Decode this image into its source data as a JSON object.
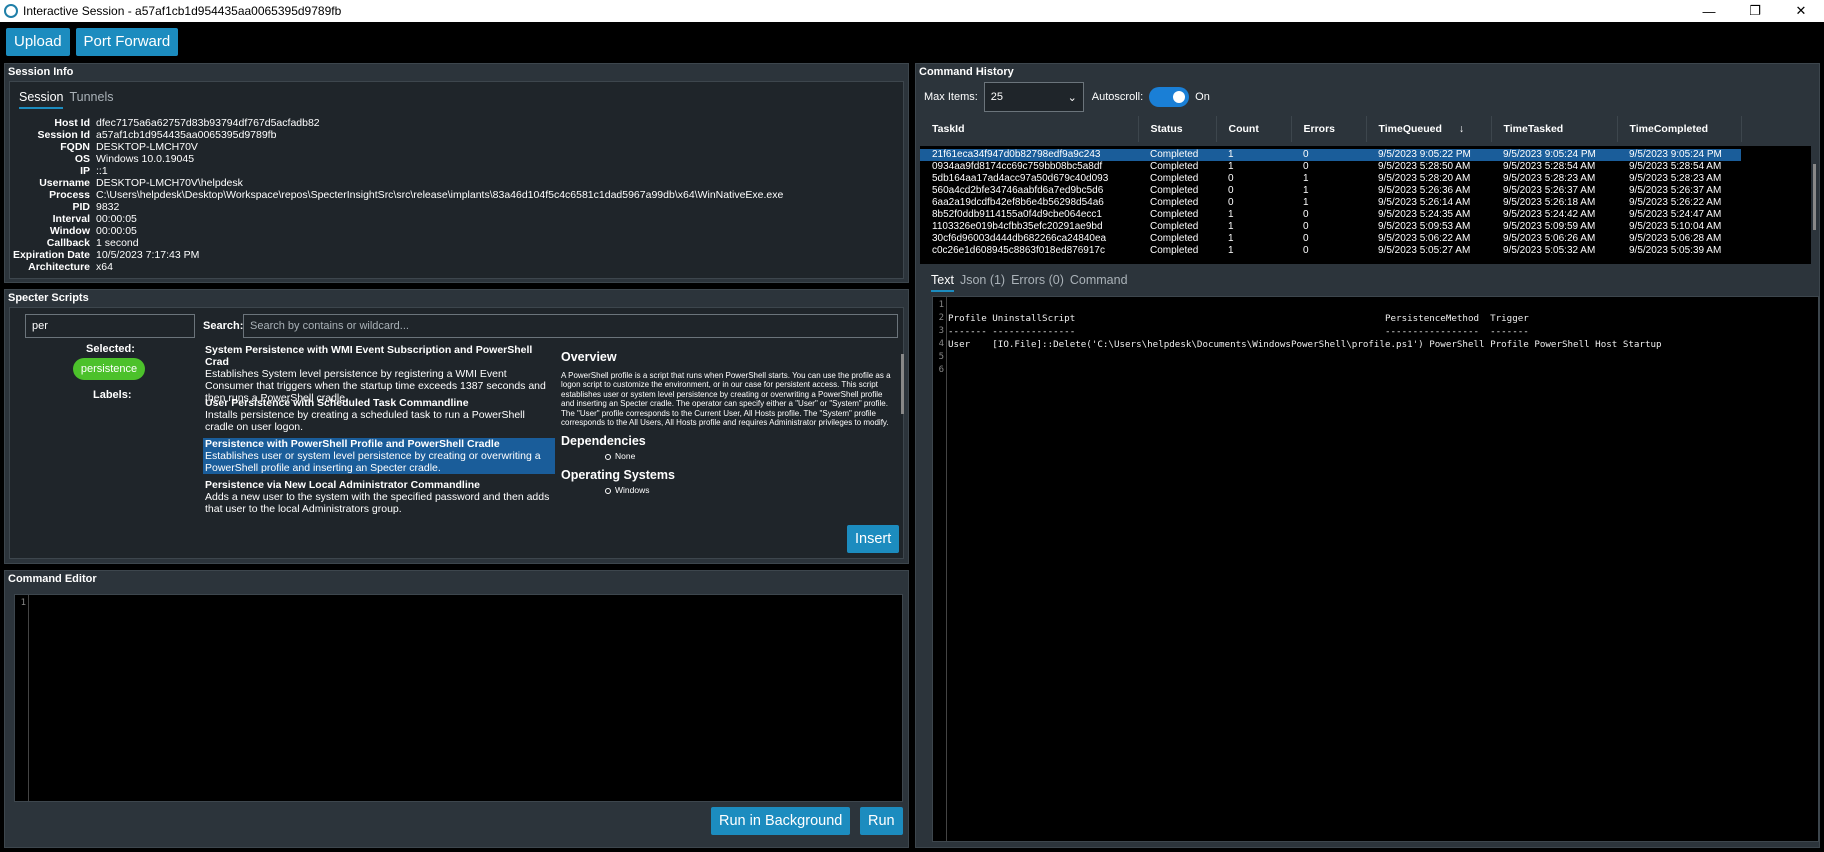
{
  "window": {
    "title": "Interactive Session - a57af1cb1d954435aa0065395d9789fb",
    "minimize": "—",
    "maximize": "❐",
    "close": "✕"
  },
  "toolbar": {
    "upload": "Upload",
    "port_forward": "Port Forward"
  },
  "session_info": {
    "header": "Session Info",
    "tabs": [
      "Session",
      "Tunnels"
    ],
    "fields": [
      {
        "k": "Host Id",
        "v": "dfec7175a6a62757d83b93794df767d5acfadb82"
      },
      {
        "k": "Session Id",
        "v": "a57af1cb1d954435aa0065395d9789fb"
      },
      {
        "k": "FQDN",
        "v": "DESKTOP-LMCH70V"
      },
      {
        "k": "OS",
        "v": "Windows 10.0.19045"
      },
      {
        "k": "IP",
        "v": "::1"
      },
      {
        "k": "Username",
        "v": "DESKTOP-LMCH70V\\helpdesk"
      },
      {
        "k": "Process",
        "v": "C:\\Users\\helpdesk\\Desktop\\Workspace\\repos\\SpecterInsightSrc\\src\\release\\implants\\83a46d104f5c4c6581c1dad5967a99db\\x64\\WinNativeExe.exe"
      },
      {
        "k": "PID",
        "v": "9832"
      },
      {
        "k": "Interval",
        "v": "00:00:05"
      },
      {
        "k": "Window",
        "v": "00:00:05"
      },
      {
        "k": "Callback",
        "v": "1 second"
      },
      {
        "k": "Expiration Date",
        "v": "10/5/2023 7:17:43 PM"
      },
      {
        "k": "Architecture",
        "v": "x64"
      }
    ]
  },
  "scripts": {
    "header": "Specter Scripts",
    "filter_value": "per",
    "search_label": "Search:",
    "search_placeholder": "Search by contains or wildcard...",
    "selected_label": "Selected:",
    "selected_pill": "persistence",
    "labels_label": "Labels:",
    "items": [
      {
        "name": "System Persistence with WMI Event Subscription and PowerShell Crad",
        "desc": "Establishes System level persistence by registering a WMI Event Consumer that triggers when the startup time exceeds 1387 seconds and then runs a PowerShell cradle."
      },
      {
        "name": "User Persistence with Scheduled Task Commandline",
        "desc": "Installs persistence by creating a scheduled task to run a PowerShell cradle on user logon."
      },
      {
        "name": "Persistence with PowerShell Profile and PowerShell Cradle",
        "desc": "Establishes user or system level persistence by creating or overwriting a PowerShell profile and inserting an Specter cradle."
      },
      {
        "name": "Persistence via New Local Administrator Commandline",
        "desc": "Adds a new user to the system with the specified password and then adds that user to the local Administrators group."
      }
    ],
    "overview_title": "Overview",
    "overview_text": "A PowerShell profile is a script that runs when PowerShell starts. You can use the profile as a logon script to customize the environment, or in our case for persistent access. This script establishes user or system level persistence by creating or overwriting a PowerShell profile and inserting an Specter cradle. The operator can specify either a \"User\" or \"System\" profile. The \"User\" profile corresponds to the Current User, All Hosts profile. The \"System\" profile corresponds to the All Users, All Hosts profile and requires Administrator privileges to modify.",
    "dependencies_title": "Dependencies",
    "dependencies_value": "None",
    "os_title": "Operating Systems",
    "os_value": "Windows",
    "insert": "Insert"
  },
  "editor": {
    "header": "Command Editor",
    "line": "1",
    "run_bg": "Run in Background",
    "run": "Run"
  },
  "history": {
    "header": "Command History",
    "max_items_label": "Max Items:",
    "max_items_value": "25",
    "autoscroll_label": "Autoscroll:",
    "autoscroll_state": "On",
    "columns": [
      "TaskId",
      "Status",
      "Count",
      "Errors",
      "TimeQueued",
      "TimeTasked",
      "TimeCompleted"
    ],
    "sort_icon": "↓",
    "rows": [
      [
        "21f61eca34f947d0b82798edf9a9c243",
        "Completed",
        "1",
        "0",
        "9/5/2023 9:05:22 PM",
        "9/5/2023 9:05:24 PM",
        "9/5/2023 9:05:24 PM"
      ],
      [
        "0934aa9fd8174cc69c759bb08bc5a8df",
        "Completed",
        "1",
        "0",
        "9/5/2023 5:28:50 AM",
        "9/5/2023 5:28:54 AM",
        "9/5/2023 5:28:54 AM"
      ],
      [
        "5db164aa17ad4acc97a50d679c40d093",
        "Completed",
        "0",
        "1",
        "9/5/2023 5:28:20 AM",
        "9/5/2023 5:28:23 AM",
        "9/5/2023 5:28:23 AM"
      ],
      [
        "560a4cd2bfe34746aabfd6a7ed9bc5d6",
        "Completed",
        "0",
        "1",
        "9/5/2023 5:26:36 AM",
        "9/5/2023 5:26:37 AM",
        "9/5/2023 5:26:37 AM"
      ],
      [
        "6aa2a19dcdfb42ef8b6e4b56298d54a6",
        "Completed",
        "0",
        "1",
        "9/5/2023 5:26:14 AM",
        "9/5/2023 5:26:18 AM",
        "9/5/2023 5:26:22 AM"
      ],
      [
        "8b52f0ddb9114155a0f4d9cbe064ecc1",
        "Completed",
        "1",
        "0",
        "9/5/2023 5:24:35 AM",
        "9/5/2023 5:24:42 AM",
        "9/5/2023 5:24:47 AM"
      ],
      [
        "1103326e019b4cfbb35efc20291ae9bd",
        "Completed",
        "1",
        "0",
        "9/5/2023 5:09:53 AM",
        "9/5/2023 5:09:59 AM",
        "9/5/2023 5:10:04 AM"
      ],
      [
        "30cf6d96003d444db682266ca24840ea",
        "Completed",
        "1",
        "0",
        "9/5/2023 5:06:22 AM",
        "9/5/2023 5:06:26 AM",
        "9/5/2023 5:06:28 AM"
      ],
      [
        "c0c26e1d608945c8863f018ed876917c",
        "Completed",
        "1",
        "0",
        "9/5/2023 5:05:27 AM",
        "9/5/2023 5:05:32 AM",
        "9/5/2023 5:05:39 AM"
      ]
    ],
    "output_tabs": [
      "Text",
      "Json (1)",
      "Errors (0)",
      "Command"
    ],
    "output_lines": [
      "",
      "Profile UninstallScript                                                        PersistenceMethod  Trigger",
      "------- ---------------                                                        -----------------  -------",
      "User    [IO.File]::Delete('C:\\Users\\helpdesk\\Documents\\WindowsPowerShell\\profile.ps1') PowerShell Profile PowerShell Host Startup",
      "",
      ""
    ]
  }
}
